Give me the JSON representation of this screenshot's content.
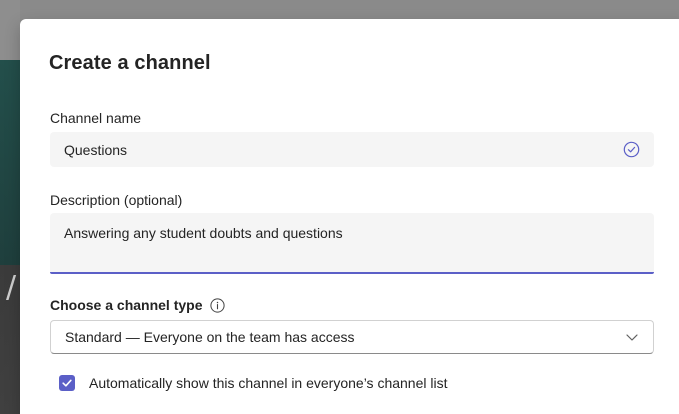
{
  "dialog": {
    "title": "Create a channel",
    "channel_name": {
      "label": "Channel name",
      "value": "Questions",
      "status_icon": "check-circle-icon"
    },
    "description": {
      "label": "Description (optional)",
      "value": "Answering any student doubts and questions"
    },
    "channel_type": {
      "label": "Choose a channel type",
      "info_icon": "info-icon",
      "selected": "Standard — Everyone on the team has access",
      "dropdown_icon": "chevron-down-icon"
    },
    "auto_show": {
      "checked": true,
      "label": "Automatically show this channel in everyone’s channel list"
    }
  },
  "colors": {
    "accent": "#5b5fc7",
    "field_background": "#f5f5f5",
    "text": "#242424"
  }
}
